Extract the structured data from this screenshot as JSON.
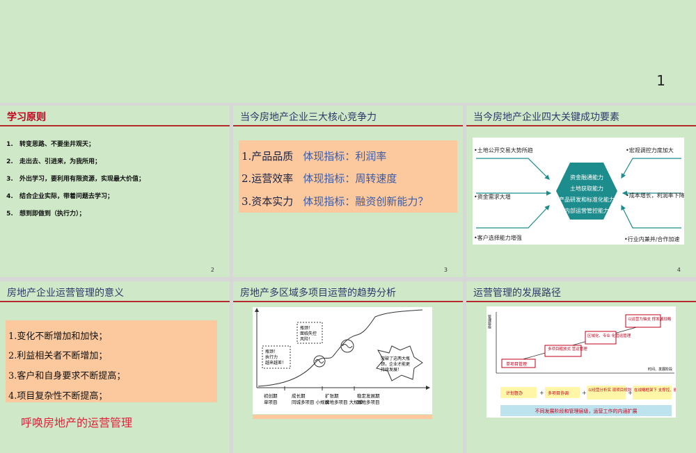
{
  "top_page_number": "1",
  "slides": [
    {
      "title": "学习原则",
      "number": "2",
      "items": [
        "转变思路、不要坐井观天；",
        "走出去、引进来，为我所用；",
        "外出学习，要利用有限资源，实现最大价值；",
        "结合企业实际，带着问题去学习；",
        "想到即做到（执行力）；"
      ]
    },
    {
      "title": "当今房地产企业三大核心竞争力",
      "number": "3",
      "rows": [
        {
          "label": "1.产品品质",
          "indicator": "体现指标：利润率"
        },
        {
          "label": "2.运营效率",
          "indicator": "体现指标：周转速度"
        },
        {
          "label": "3.资本实力",
          "indicator": "体现指标：融资创新能力？"
        }
      ]
    },
    {
      "title": "当今房地产企业四大关键成功要素",
      "number": "4",
      "left_factors": [
        "•土地公开交易大势所趋",
        "•资金需求大增",
        "•客户选择能力增强"
      ],
      "right_factors": [
        "•宏观调控力度加大",
        "•成本增长，利润率下降",
        "•行业内兼并/合作加速"
      ],
      "core": [
        "资金融通能力",
        "土地获取能力",
        "产品研发和标准化能力",
        "内部运营管控能力"
      ]
    },
    {
      "title": "房地产企业运营管理的意义",
      "items": [
        "1.变化不断增加和加快；",
        "2.利益相关者不断增加；",
        "3.客户和自身要求不断提高；",
        "4.项目复杂性不断提高；"
      ],
      "tail": "呼唤房地产的运营管理"
    },
    {
      "title": "房地产多区域多项目运营的趋势分析",
      "bubbles": {
        "b1": [
          "瓶颈！",
          "面临失控",
          "风险！"
        ],
        "b2": [
          "瓶颈！",
          "执行力",
          "越来越差！"
        ],
        "b3": [
          "突破了这两大瓶",
          "颈，企业才能更",
          "持续发展！"
        ]
      },
      "phases": [
        {
          "name": "初创期",
          "desc": "单项目"
        },
        {
          "name": "成长期",
          "desc": "同城多项目 小规模"
        },
        {
          "name": "扩张期",
          "desc": "异地多项目 大规模"
        },
        {
          "name": "稳定发展期",
          "desc": "异地多项目"
        }
      ]
    },
    {
      "title": "运营管理的发展路径",
      "y_axis": "管理层级",
      "x_axis": "时间、发展阶段",
      "steps": [
        "单项目管理",
        "多项目粗放式 营运管理",
        "区域化、专业 化营运管理",
        "以运营为轴支 撑发展战略"
      ],
      "flow": [
        "计划督办",
        "多项目协调",
        "以经营分析实 现项目规划",
        "在战略框架下 支撑控、融资"
      ],
      "note": "不同发展阶段和管理层级，运营工作的内涵扩展"
    }
  ],
  "colors": {
    "accent_red": "#b5282b",
    "slide_bg": "#cfe8c8",
    "box_orange": "#fcc99f",
    "teal": "#1c8c8c"
  }
}
